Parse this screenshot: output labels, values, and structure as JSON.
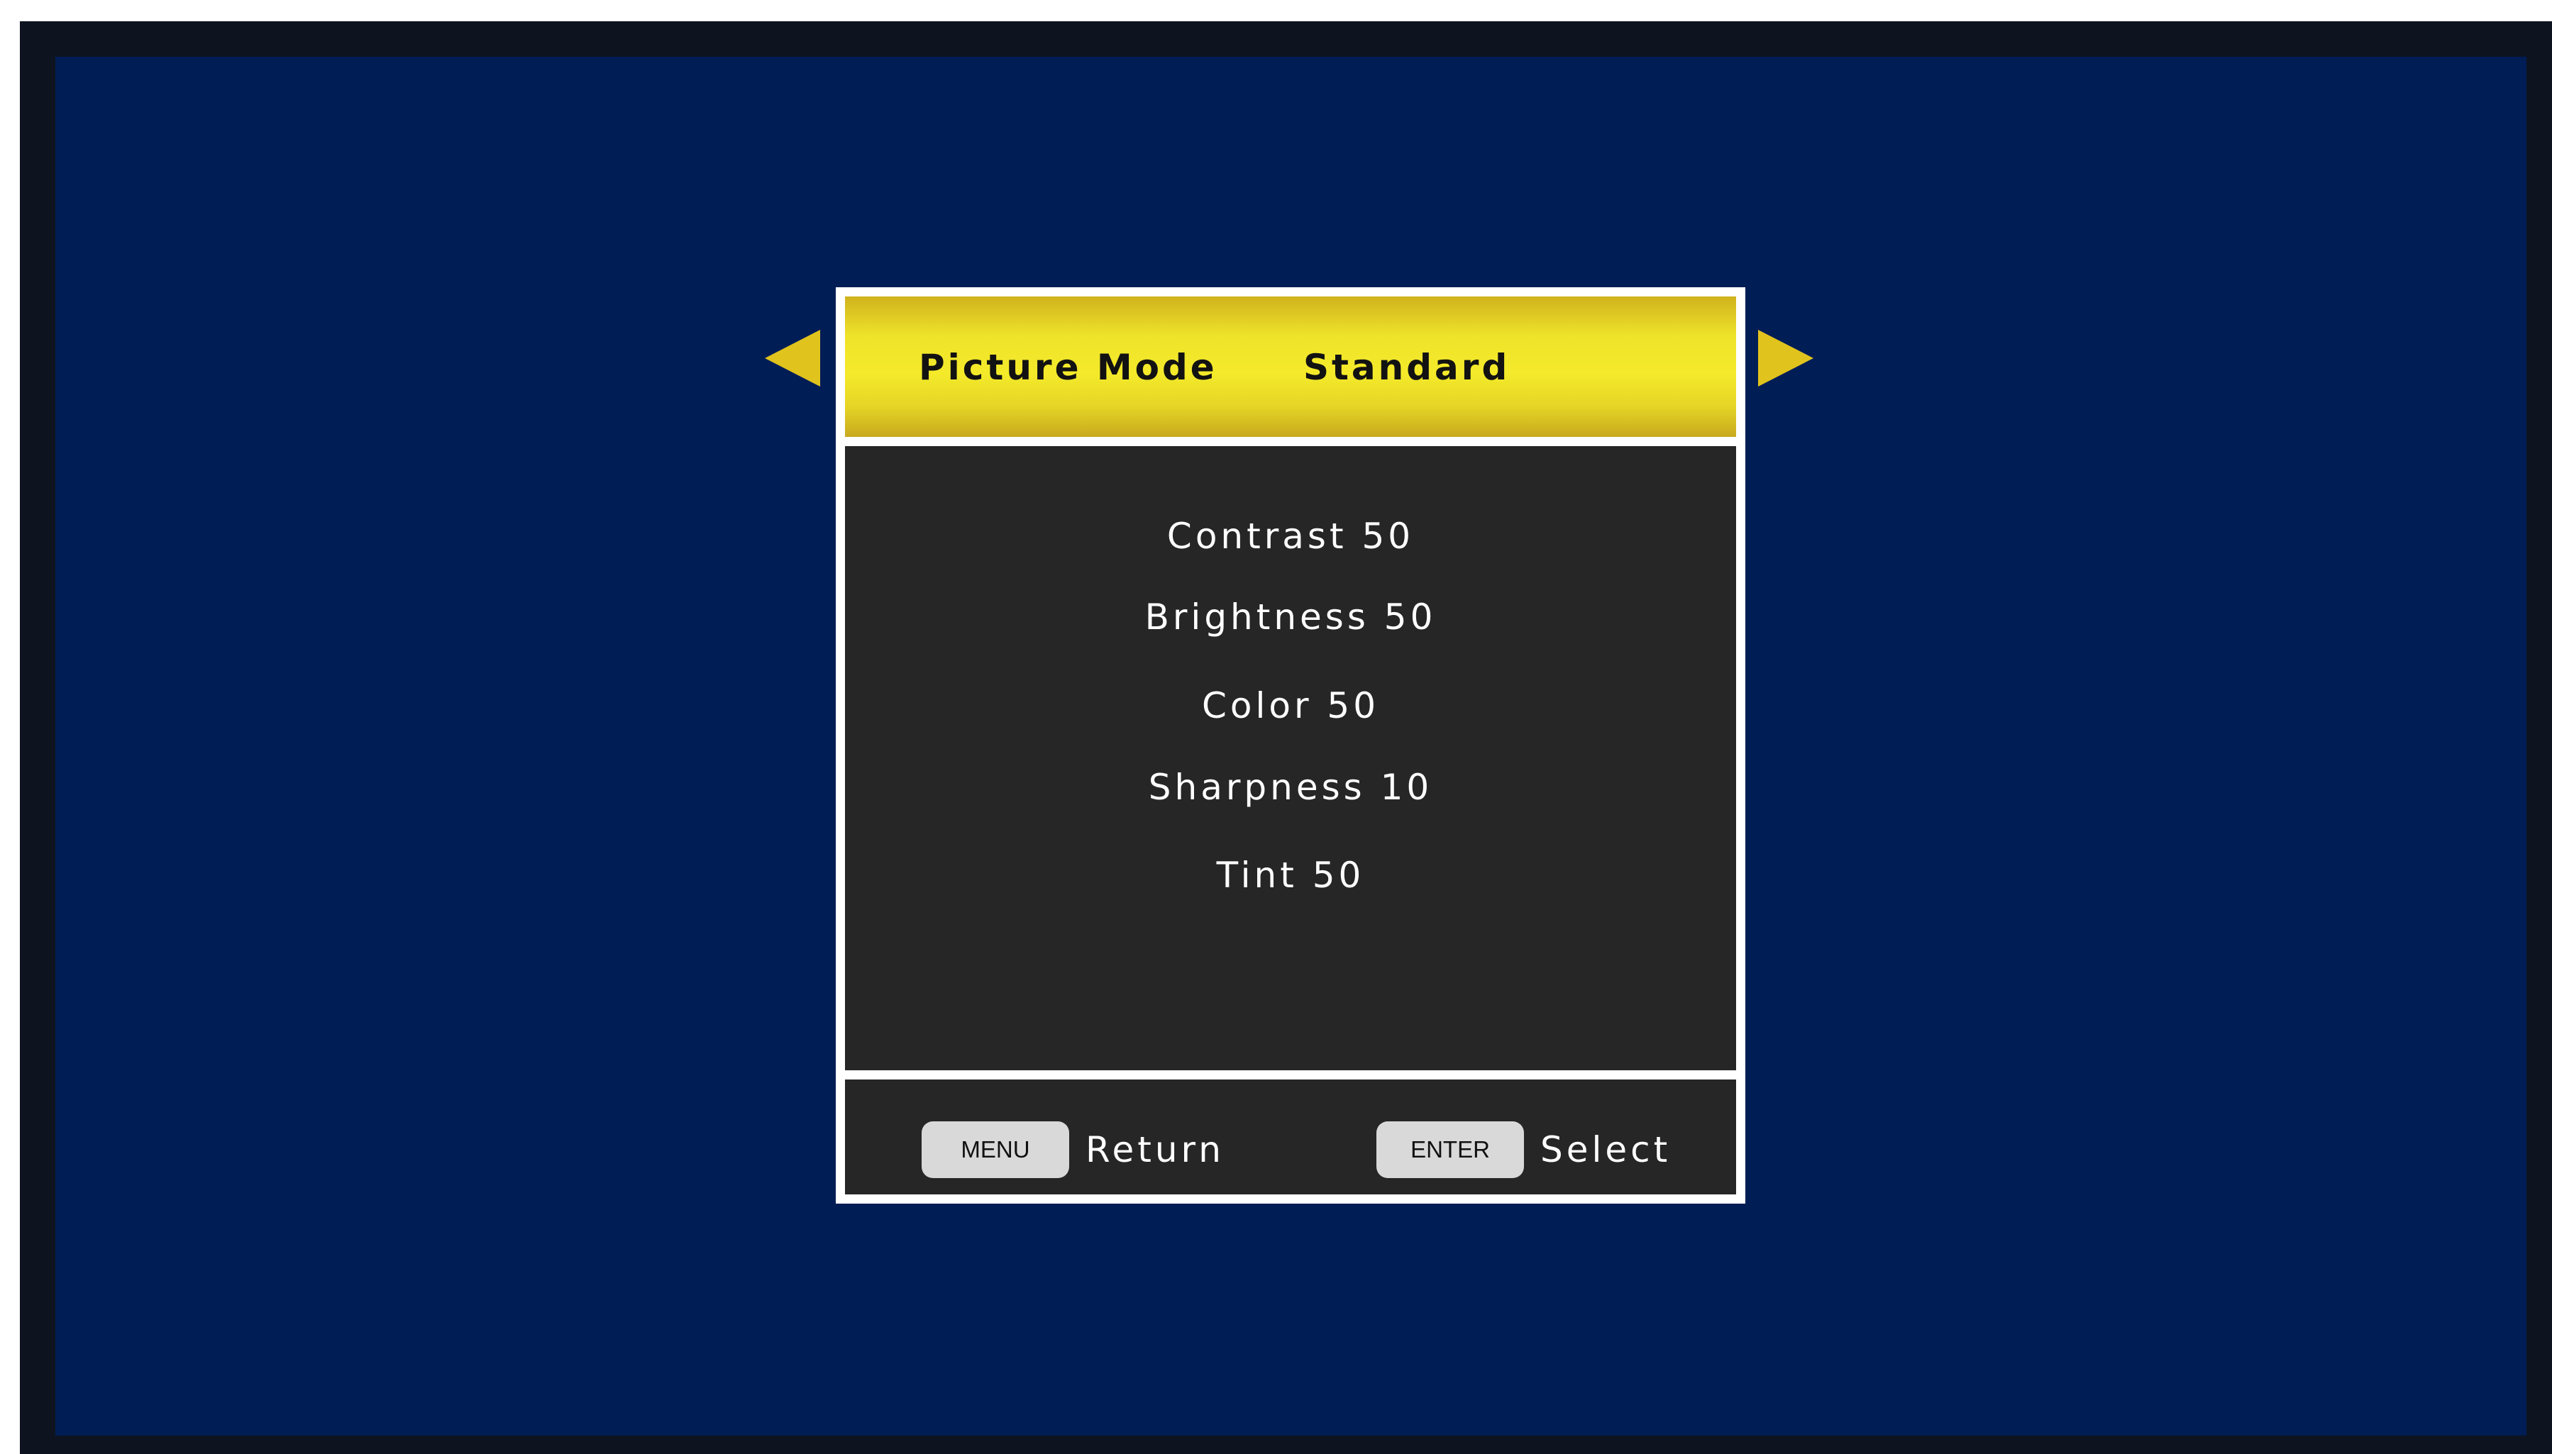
{
  "header": {
    "label": "Picture Mode",
    "value": "Standard"
  },
  "settings": [
    {
      "label": "Contrast 50"
    },
    {
      "label": "Brightness 50"
    },
    {
      "label": "Color 50"
    },
    {
      "label": "Sharpness 10"
    },
    {
      "label": "Tint 50"
    }
  ],
  "footer": {
    "menu_key": "MENU",
    "menu_action": "Return",
    "enter_key": "ENTER",
    "enter_action": "Select"
  },
  "icons": {
    "prev": "arrow-left-icon",
    "next": "arrow-right-icon"
  },
  "colors": {
    "screen_background": "#001d55",
    "bezel": "#0d141f",
    "header_yellow": "#f4ea2a",
    "arrow_yellow": "#e1c31e",
    "panel_body": "#262626",
    "panel_border": "#ffffff",
    "key_button": "#d9d9d9"
  }
}
